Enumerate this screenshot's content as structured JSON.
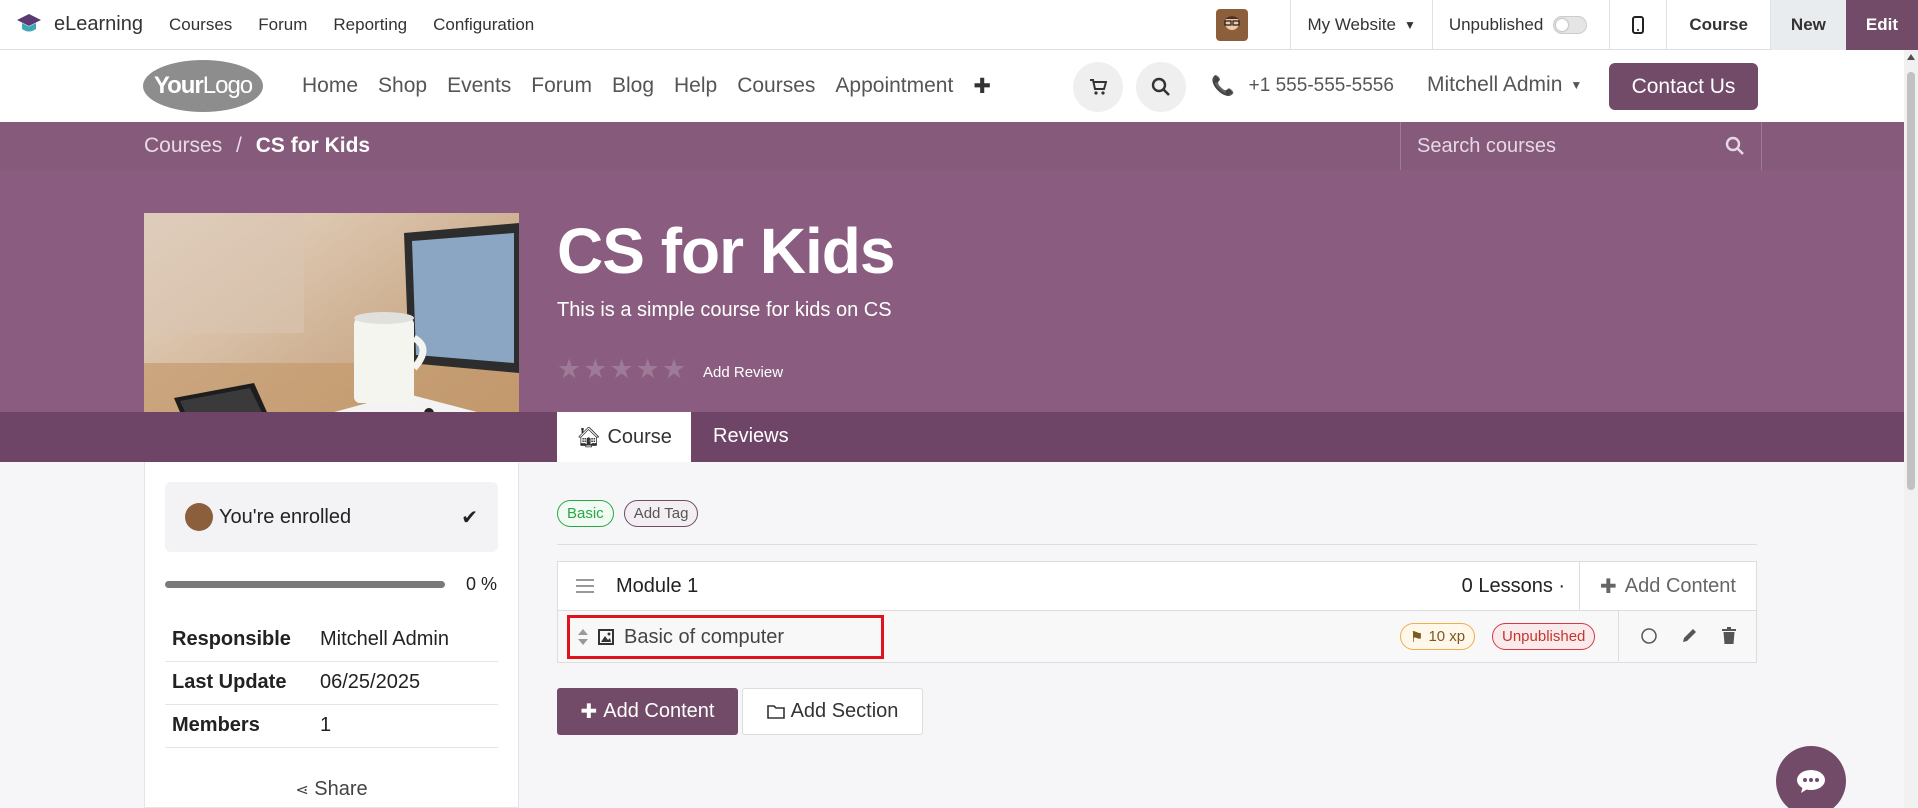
{
  "topbar": {
    "app_name": "eLearning",
    "menu": [
      "Courses",
      "Forum",
      "Reporting",
      "Configuration"
    ],
    "website_label": "My Website",
    "publish_label": "Unpublished",
    "course_label": "Course",
    "new_label": "New",
    "edit_label": "Edit"
  },
  "site_header": {
    "logo_text_bold": "Your",
    "logo_text": "Logo",
    "nav": [
      "Home",
      "Shop",
      "Events",
      "Forum",
      "Blog",
      "Help",
      "Courses",
      "Appointment"
    ],
    "phone": "+1 555-555-5556",
    "user": "Mitchell Admin",
    "contact_label": "Contact Us"
  },
  "hero": {
    "breadcrumb_root": "Courses",
    "breadcrumb_sep": "/",
    "breadcrumb_current": "CS for Kids",
    "search_placeholder": "Search courses",
    "title": "CS for Kids",
    "subtitle": "This is a simple course for kids on CS",
    "rating": 0,
    "add_review_label": "Add Review",
    "tabs": [
      "Course",
      "Reviews"
    ]
  },
  "sidebar": {
    "enrolled_label": "You're enrolled",
    "progress_pct": 0,
    "progress_label": "0 %",
    "info": [
      {
        "label": "Responsible",
        "value": "Mitchell Admin"
      },
      {
        "label": "Last Update",
        "value": "06/25/2025"
      },
      {
        "label": "Members",
        "value": "1"
      }
    ],
    "share_label": "Share"
  },
  "content": {
    "tags": [
      "Basic",
      "Add Tag"
    ],
    "module": {
      "title": "Module 1",
      "lessons": "0 Lessons ·",
      "add_content_label": "Add Content"
    },
    "lesson": {
      "title": "Basic of computer",
      "xp": "10 xp",
      "status": "Unpublished"
    },
    "add_content_button": "Add Content",
    "add_section_button": "Add Section"
  },
  "colors": {
    "brand": "#714b67",
    "hero": "#8a5d80",
    "highlight": "#e0131c"
  }
}
